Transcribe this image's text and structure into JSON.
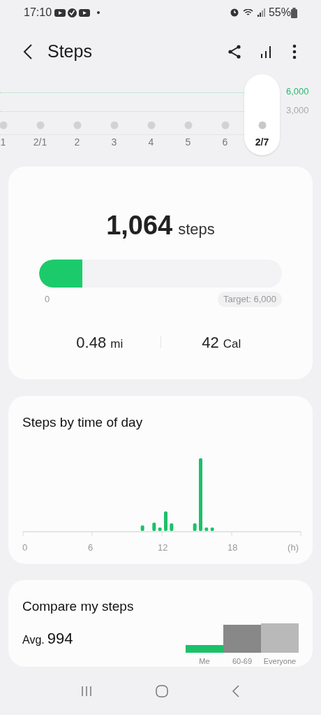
{
  "status_bar": {
    "time": "17:10",
    "battery": "55%"
  },
  "header": {
    "title": "Steps"
  },
  "day_strip": {
    "goal_label": "6,000",
    "mid_label": "3,000",
    "days": [
      {
        "label": "1",
        "selected": false
      },
      {
        "label": "2/1",
        "selected": false
      },
      {
        "label": "2",
        "selected": false
      },
      {
        "label": "3",
        "selected": false
      },
      {
        "label": "4",
        "selected": false
      },
      {
        "label": "5",
        "selected": false
      },
      {
        "label": "6",
        "selected": false
      },
      {
        "label": "2/7",
        "selected": true
      }
    ]
  },
  "summary": {
    "count": "1,064",
    "unit": "steps",
    "progress": {
      "level": 0.177,
      "min_label": "0",
      "target_label": "Target: 6,000"
    },
    "distance": {
      "value": "0.48",
      "unit": "mi"
    },
    "calories": {
      "value": "42",
      "unit": "Cal"
    }
  },
  "hourly": {
    "title": "Steps by time of day",
    "axis_labels": [
      "0",
      "6",
      "12",
      "18",
      "(h)"
    ]
  },
  "compare": {
    "title": "Compare my steps",
    "avg_label": "Avg.",
    "avg_value": "994",
    "bars": [
      {
        "label": "Me",
        "color": "#1dc06a"
      },
      {
        "label": "60-69",
        "color": "#888888"
      },
      {
        "label": "Everyone",
        "color": "#b9b9b9"
      }
    ]
  }
}
